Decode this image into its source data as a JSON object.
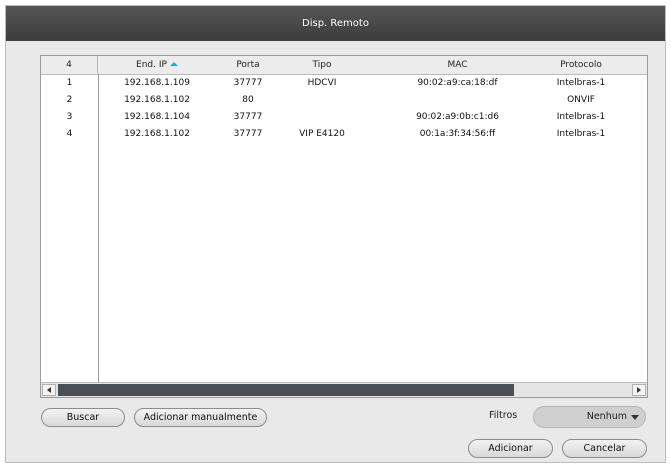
{
  "dialog": {
    "title": "Disp. Remoto"
  },
  "table": {
    "columns": [
      "4",
      "End. IP",
      "Porta",
      "Tipo",
      "MAC",
      "Protocolo"
    ],
    "rows": [
      {
        "idx": "1",
        "ip": "192.168.1.109",
        "porta": "37777",
        "tipo": "HDCVI",
        "mac": "90:02:a9:ca:18:df",
        "protocolo": "Intelbras-1"
      },
      {
        "idx": "2",
        "ip": "192.168.1.102",
        "porta": "80",
        "tipo": "",
        "mac": "",
        "protocolo": "ONVIF"
      },
      {
        "idx": "3",
        "ip": "192.168.1.104",
        "porta": "37777",
        "tipo": "",
        "mac": "90:02:a9:0b:c1:d6",
        "protocolo": "Intelbras-1"
      },
      {
        "idx": "4",
        "ip": "192.168.1.102",
        "porta": "37777",
        "tipo": "VIP E4120",
        "mac": "00:1a:3f:34:56:ff",
        "protocolo": "Intelbras-1"
      }
    ],
    "sort_indicator_color": "#2aa7d8"
  },
  "buttons": {
    "buscar": "Buscar",
    "adicionar_manual": "Adicionar manualmente",
    "adicionar": "Adicionar",
    "cancelar": "Cancelar"
  },
  "filter": {
    "label": "Filtros",
    "selected": "Nenhum"
  },
  "icons": {
    "sort": "sort-ascending-icon",
    "scroll_left": "scroll-left-icon",
    "scroll_right": "scroll-right-icon",
    "dropdown": "chevron-down-icon"
  },
  "colors": {
    "title_bar": "#454545",
    "dialog_bg": "#e9e9e9",
    "scroll_thumb": "#4a4f55"
  }
}
